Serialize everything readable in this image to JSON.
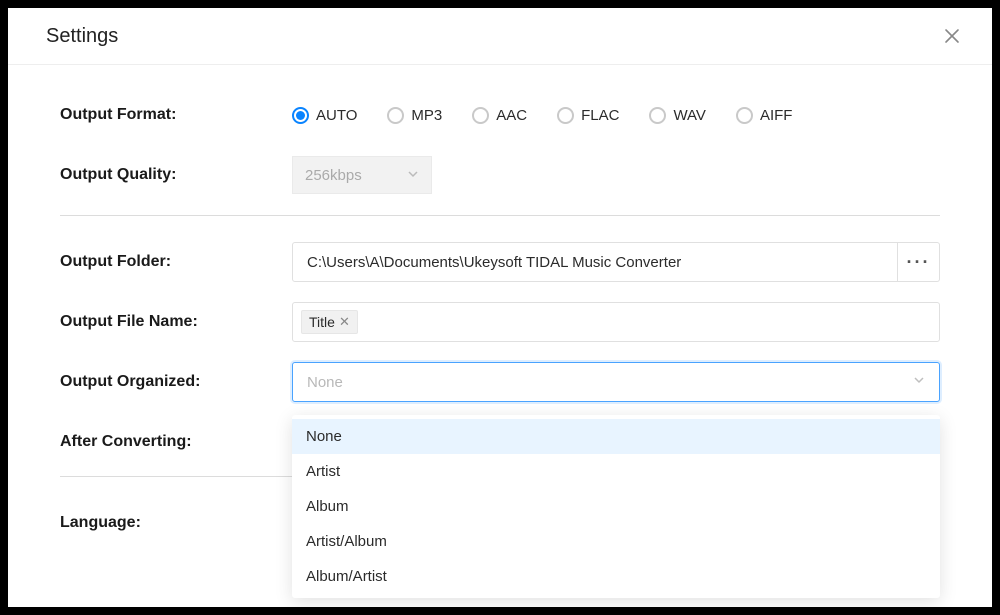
{
  "header": {
    "title": "Settings",
    "close_icon": "×"
  },
  "labels": {
    "output_format": "Output Format:",
    "output_quality": "Output Quality:",
    "output_folder": "Output Folder:",
    "output_file_name": "Output File Name:",
    "output_organized": "Output Organized:",
    "after_converting": "After Converting:",
    "language": "Language:"
  },
  "output_format": {
    "options": [
      "AUTO",
      "MP3",
      "AAC",
      "FLAC",
      "WAV",
      "AIFF"
    ],
    "selected": "AUTO"
  },
  "output_quality": {
    "value": "256kbps"
  },
  "output_folder": {
    "path": "C:\\Users\\A\\Documents\\Ukeysoft TIDAL Music Converter",
    "browse": "···"
  },
  "output_file_name": {
    "tags": [
      "Title"
    ]
  },
  "output_organized": {
    "placeholder": "None",
    "options": [
      "None",
      "Artist",
      "Album",
      "Artist/Album",
      "Album/Artist"
    ],
    "highlighted": "None"
  }
}
